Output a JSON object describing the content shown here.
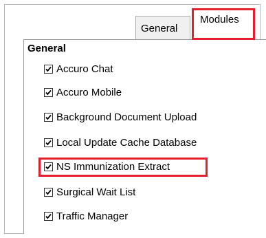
{
  "tabs": [
    {
      "label": "General"
    },
    {
      "label": "Modules"
    }
  ],
  "group": {
    "title": "General",
    "items": [
      {
        "label": "Accuro Chat",
        "checked": true
      },
      {
        "label": "Accuro Mobile",
        "checked": true
      },
      {
        "label": "Background Document Upload",
        "checked": true
      },
      {
        "label": "Local Update Cache Database",
        "checked": true
      },
      {
        "label": "NS Immunization Extract",
        "checked": true
      },
      {
        "label": "Surgical Wait List",
        "checked": true
      },
      {
        "label": "Traffic Manager",
        "checked": true
      }
    ]
  },
  "colors": {
    "highlight": "#e41e2c",
    "tab_inactive_bg": "#f0f0f0"
  }
}
